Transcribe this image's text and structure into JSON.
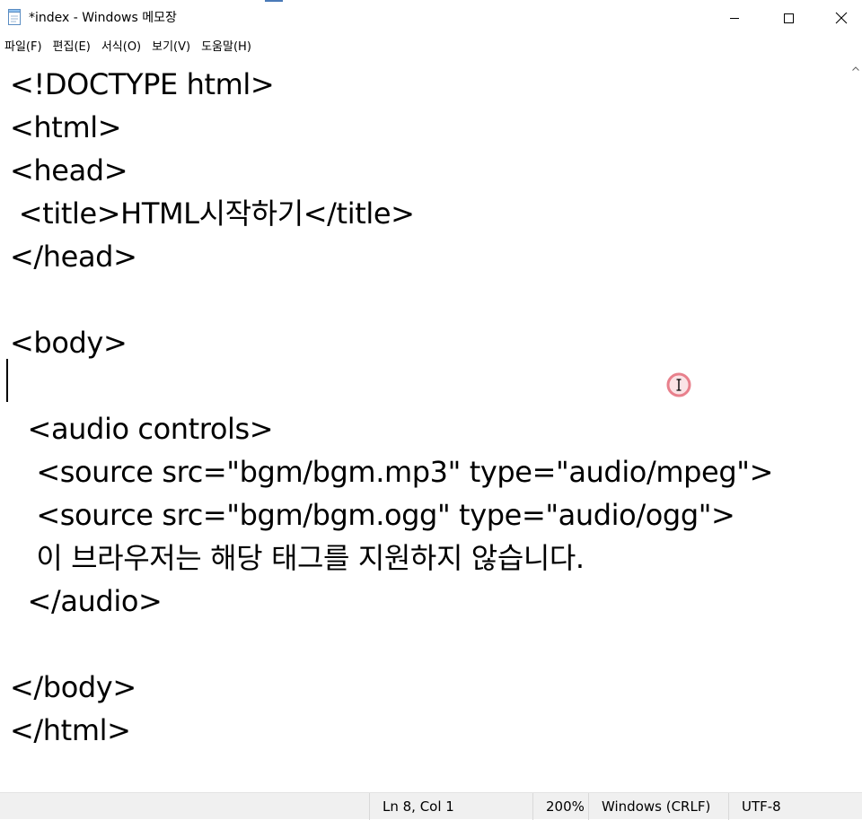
{
  "window": {
    "title": "*index - Windows 메모장"
  },
  "menu": {
    "items": [
      "파일(F)",
      "편집(E)",
      "서식(O)",
      "보기(V)",
      "도움말(H)"
    ]
  },
  "editor": {
    "lines": [
      "<!DOCTYPE html>",
      "<html>",
      "<head>",
      " <title>HTML시작하기</title>",
      "</head>",
      "",
      "<body>",
      "",
      "  <audio controls>",
      "   <source src=\"bgm/bgm.mp3\" type=\"audio/mpeg\">",
      "   <source src=\"bgm/bgm.ogg\" type=\"audio/ogg\">",
      "   이 브라우저는 해당 태그를 지원하지 않습니다.",
      "  </audio>",
      "",
      "</body>",
      "</html>"
    ]
  },
  "status": {
    "position": "Ln 8, Col 1",
    "zoom": "200%",
    "line_ending": "Windows (CRLF)",
    "encoding": "UTF-8"
  },
  "colors": {
    "cursor_ring": "#e8808c"
  },
  "icons": {
    "app": "notepad-icon",
    "minimize": "minimize-icon",
    "maximize": "maximize-icon",
    "close": "close-icon",
    "cursor": "text-cursor-icon"
  }
}
